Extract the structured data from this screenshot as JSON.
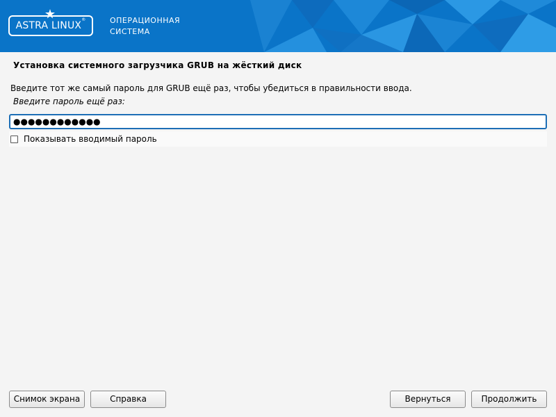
{
  "banner": {
    "logo_text": "ASTRA LINUX",
    "logo_mark": "®",
    "os_line1": "ОПЕРАЦИОННАЯ",
    "os_line2": "СИСТЕМА",
    "background_color": "#0a74c8",
    "logo_icon": "star-icon"
  },
  "main": {
    "title": "Установка системного загрузчика GRUB на жёсткий диск",
    "description": "Введите тот же самый пароль для GRUB ещё раз, чтобы убедиться в правильности ввода.",
    "prompt": "Введите пароль ещё раз:",
    "password_value": "●●●●●●●●●●●●",
    "show_password_label": "Показывать вводимый пароль",
    "show_password_checked": false
  },
  "footer": {
    "screenshot_label": "Снимок экрана",
    "help_label": "Справка",
    "back_label": "Вернуться",
    "continue_label": "Продолжить"
  }
}
